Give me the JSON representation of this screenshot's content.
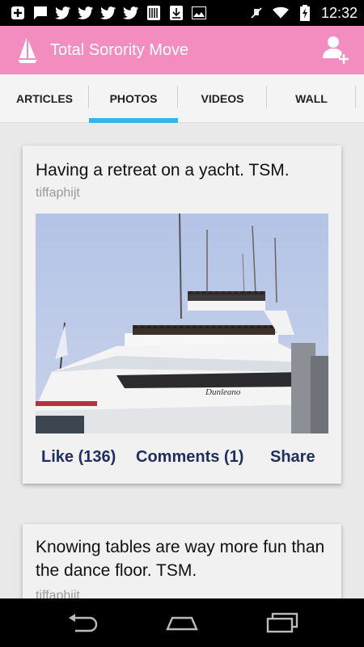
{
  "status_bar": {
    "time": "12:32",
    "left_icons": [
      "add-notification-icon",
      "chat-notification-icon",
      "twitter-icon",
      "twitter-icon",
      "twitter-icon",
      "twitter-icon",
      "barcode-icon",
      "download-icon",
      "image-icon"
    ],
    "right_icons": [
      "muted-icon",
      "wifi-icon",
      "battery-charging-icon"
    ]
  },
  "action_bar": {
    "title": "Total Sorority Move",
    "logo_icon": "sailboat-icon",
    "action_icon": "add-user-icon",
    "color": "#f38cbf"
  },
  "tabs": [
    {
      "label": "ARTICLES",
      "active": false
    },
    {
      "label": "PHOTOS",
      "active": true
    },
    {
      "label": "VIDEOS",
      "active": false
    },
    {
      "label": "WALL",
      "active": false
    }
  ],
  "tab_indicator_color": "#33b5e5",
  "posts": [
    {
      "title": "Having a retreat on a yacht. TSM.",
      "author": "tiffaphijt",
      "like_label": "Like (136)",
      "comments_label": "Comments (1)",
      "share_label": "Share",
      "photo_caption": "Dunleano"
    },
    {
      "title": "Knowing tables are way more fun than the dance floor. TSM.",
      "author": "tiffaphijt"
    }
  ],
  "nav_bar": {
    "icons": [
      "back-icon",
      "home-icon",
      "recent-apps-icon"
    ]
  }
}
